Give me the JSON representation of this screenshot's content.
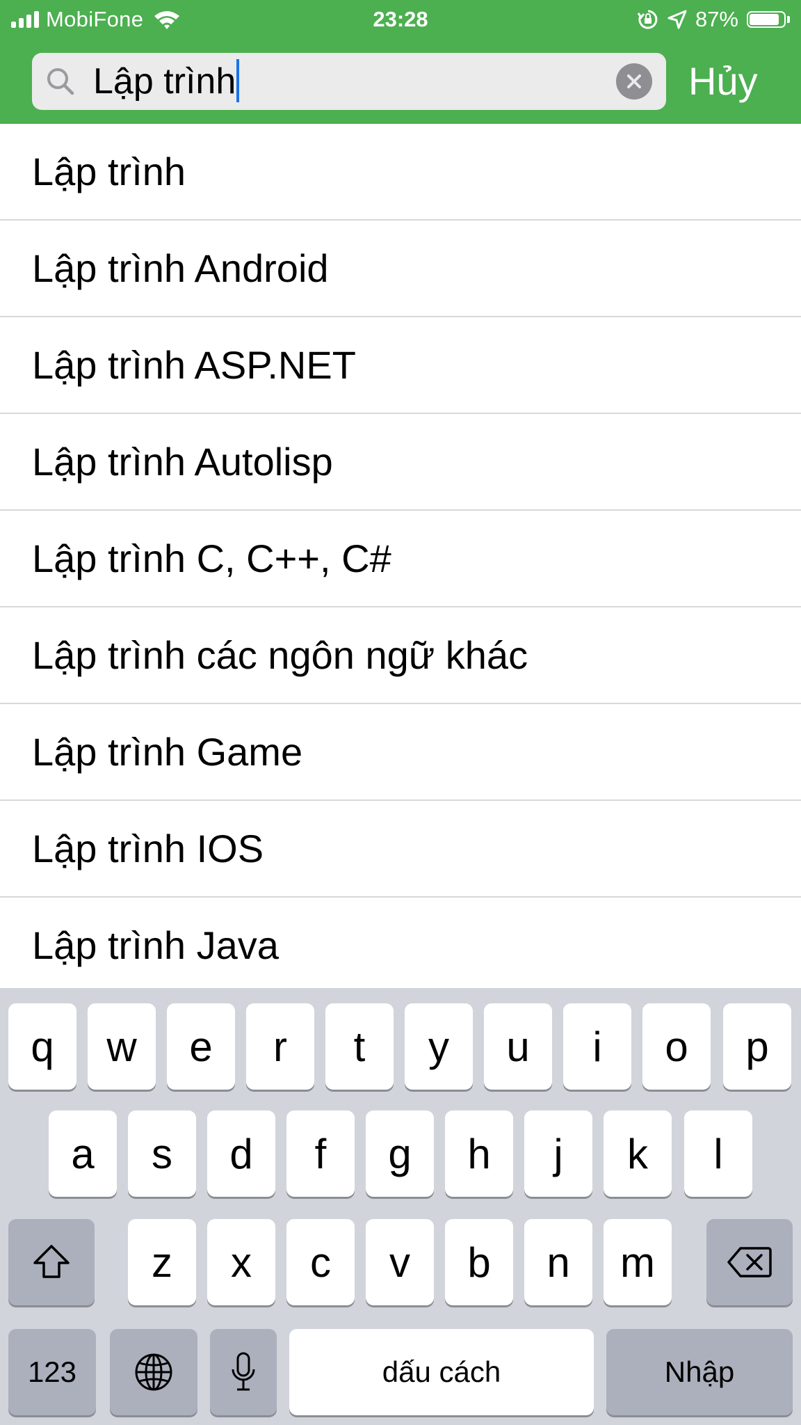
{
  "status_bar": {
    "carrier": "MobiFone",
    "time": "23:28",
    "battery_percent": "87%",
    "battery_level": 0.87,
    "icons": [
      "signal-bars-icon",
      "wifi-icon",
      "orientation-lock-icon",
      "location-arrow-icon",
      "battery-icon"
    ]
  },
  "search": {
    "value": "Lập trình",
    "cancel_label": "Hủy"
  },
  "suggestions": [
    "Lập trình",
    "Lập trình Android",
    "Lập trình ASP.NET",
    "Lập trình Autolisp",
    "Lập trình C, C++, C#",
    "Lập trình các ngôn ngữ khác",
    "Lập trình Game",
    "Lập trình IOS",
    "Lập trình Java"
  ],
  "keyboard": {
    "row1": [
      "q",
      "w",
      "e",
      "r",
      "t",
      "y",
      "u",
      "i",
      "o",
      "p"
    ],
    "row2": [
      "a",
      "s",
      "d",
      "f",
      "g",
      "h",
      "j",
      "k",
      "l"
    ],
    "row3": [
      "z",
      "x",
      "c",
      "v",
      "b",
      "n",
      "m"
    ],
    "numbers_label": "123",
    "space_label": "dấu cách",
    "return_label": "Nhập",
    "icons": [
      "shift-icon",
      "backspace-icon",
      "globe-icon",
      "microphone-icon"
    ]
  },
  "colors": {
    "header_green": "#4caf50",
    "caret_blue": "#1a73e8",
    "keyboard_bg": "#d1d4db",
    "dark_key": "#abb0bc"
  }
}
